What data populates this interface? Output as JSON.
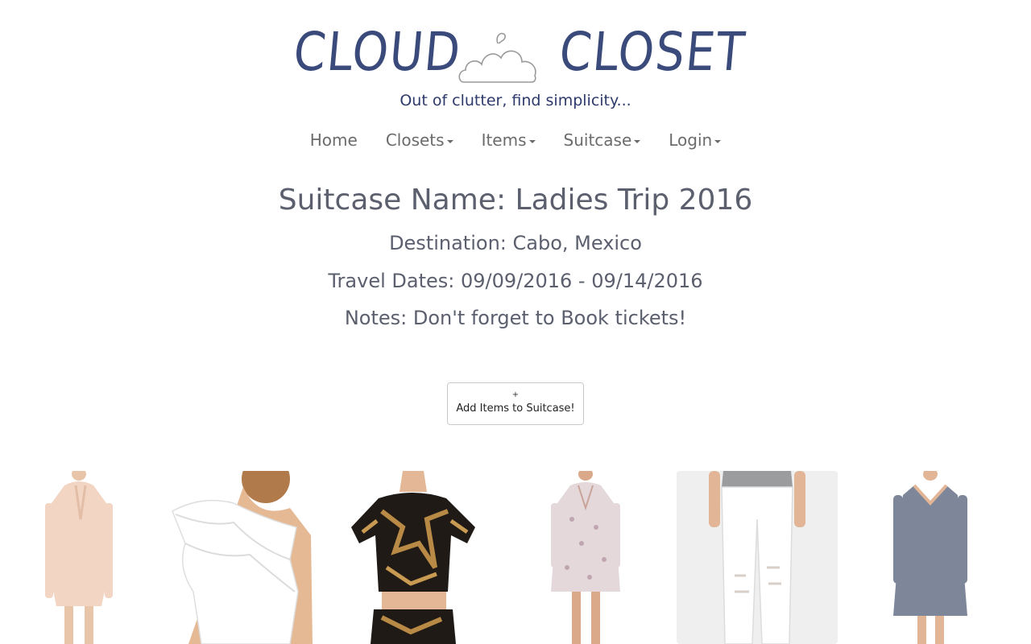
{
  "logo": {
    "word_left": "CLOUD",
    "word_right": "CLOSET",
    "icon": "cloud-hanger-icon"
  },
  "tagline": "Out of clutter, find simplicity...",
  "nav": [
    {
      "label": "Home",
      "dropdown": false
    },
    {
      "label": "Closets",
      "dropdown": true
    },
    {
      "label": "Items",
      "dropdown": true
    },
    {
      "label": "Suitcase",
      "dropdown": true
    },
    {
      "label": "Login",
      "dropdown": true
    }
  ],
  "suitcase": {
    "name": "Suitcase Name: Ladies Trip 2016",
    "destination": "Destination: Cabo, Mexico",
    "dates": "Travel Dates: 09/09/2016 - 09/14/2016",
    "notes": "Notes: Don't forget to Book tickets!"
  },
  "add_button": {
    "icon": "plus-icon",
    "plus": "+",
    "label": "Add Items to Suitcase!"
  },
  "colors": {
    "brand": "#3a4a7a",
    "tagline": "#2e3a6b",
    "text": "#5b5f6e",
    "nav": "#6b6b6b"
  },
  "items": [
    {
      "name": "blush-tie-neck-dress"
    },
    {
      "name": "white-one-shoulder-ruffle-top"
    },
    {
      "name": "sequin-crop-top"
    },
    {
      "name": "printed-shift-dress"
    },
    {
      "name": "white-distressed-jeans"
    },
    {
      "name": "grey-swing-dress"
    }
  ]
}
